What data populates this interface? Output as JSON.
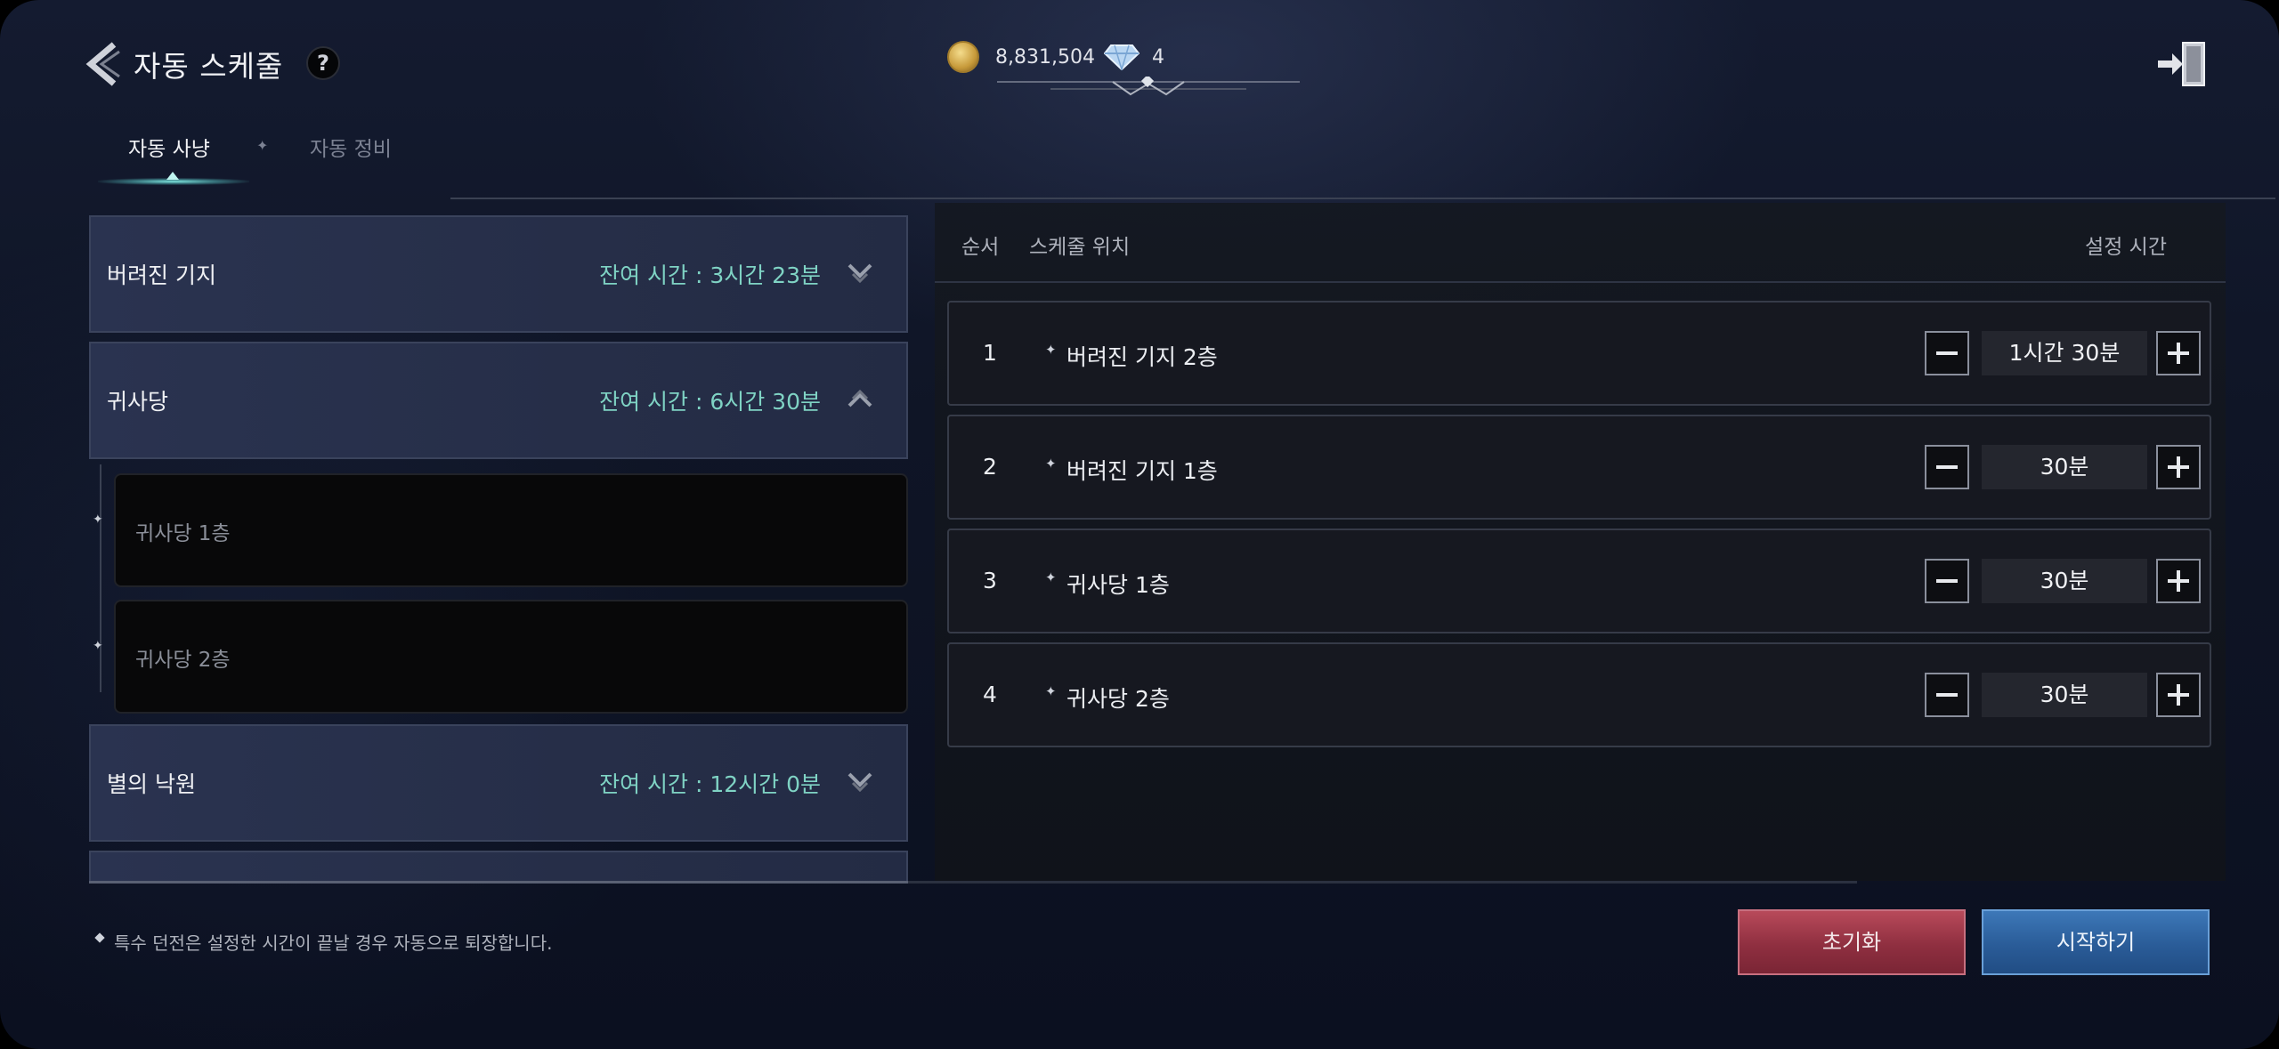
{
  "header": {
    "title": "자동 스케줄",
    "help_label": "?",
    "gold": "8,831,504",
    "diamonds": "4"
  },
  "tabs": [
    {
      "label": "자동 사냥",
      "active": true
    },
    {
      "label": "자동 정비",
      "active": false
    }
  ],
  "regions": [
    {
      "name": "버려진 기지",
      "remaining": "잔여 시간 : 3시간 23분",
      "expanded": false
    },
    {
      "name": "귀사당",
      "remaining": "잔여 시간 : 6시간 30분",
      "expanded": true
    },
    {
      "name": "별의 낙원",
      "remaining": "잔여 시간 : 12시간 0분",
      "expanded": false
    }
  ],
  "sub_items": [
    {
      "name": "귀사당 1층"
    },
    {
      "name": "귀사당 2층"
    }
  ],
  "schedule": {
    "headers": {
      "order": "순서",
      "location": "스케줄 위치",
      "time": "설정 시간"
    },
    "rows": [
      {
        "order": "1",
        "location": "버려진 기지 2층",
        "time": "1시간 30분"
      },
      {
        "order": "2",
        "location": "버려진 기지 1층",
        "time": "30분"
      },
      {
        "order": "3",
        "location": "귀사당 1층",
        "time": "30분"
      },
      {
        "order": "4",
        "location": "귀사당 2층",
        "time": "30분"
      }
    ]
  },
  "footer": {
    "note": "특수 던전은 설정한 시간이 끝날 경우 자동으로 퇴장합니다.",
    "reset_label": "초기화",
    "start_label": "시작하기"
  },
  "colors": {
    "accent_teal": "#7fd3c4",
    "reset_red": "#8f2f40",
    "start_blue": "#2a5c98"
  },
  "icons": {
    "back": "chevron-left-icon",
    "exit": "exit-door-icon",
    "gold": "gold-coin-icon",
    "diamond": "diamond-icon",
    "collapse": "chevron-up-icon",
    "expand": "chevron-down-icon"
  }
}
